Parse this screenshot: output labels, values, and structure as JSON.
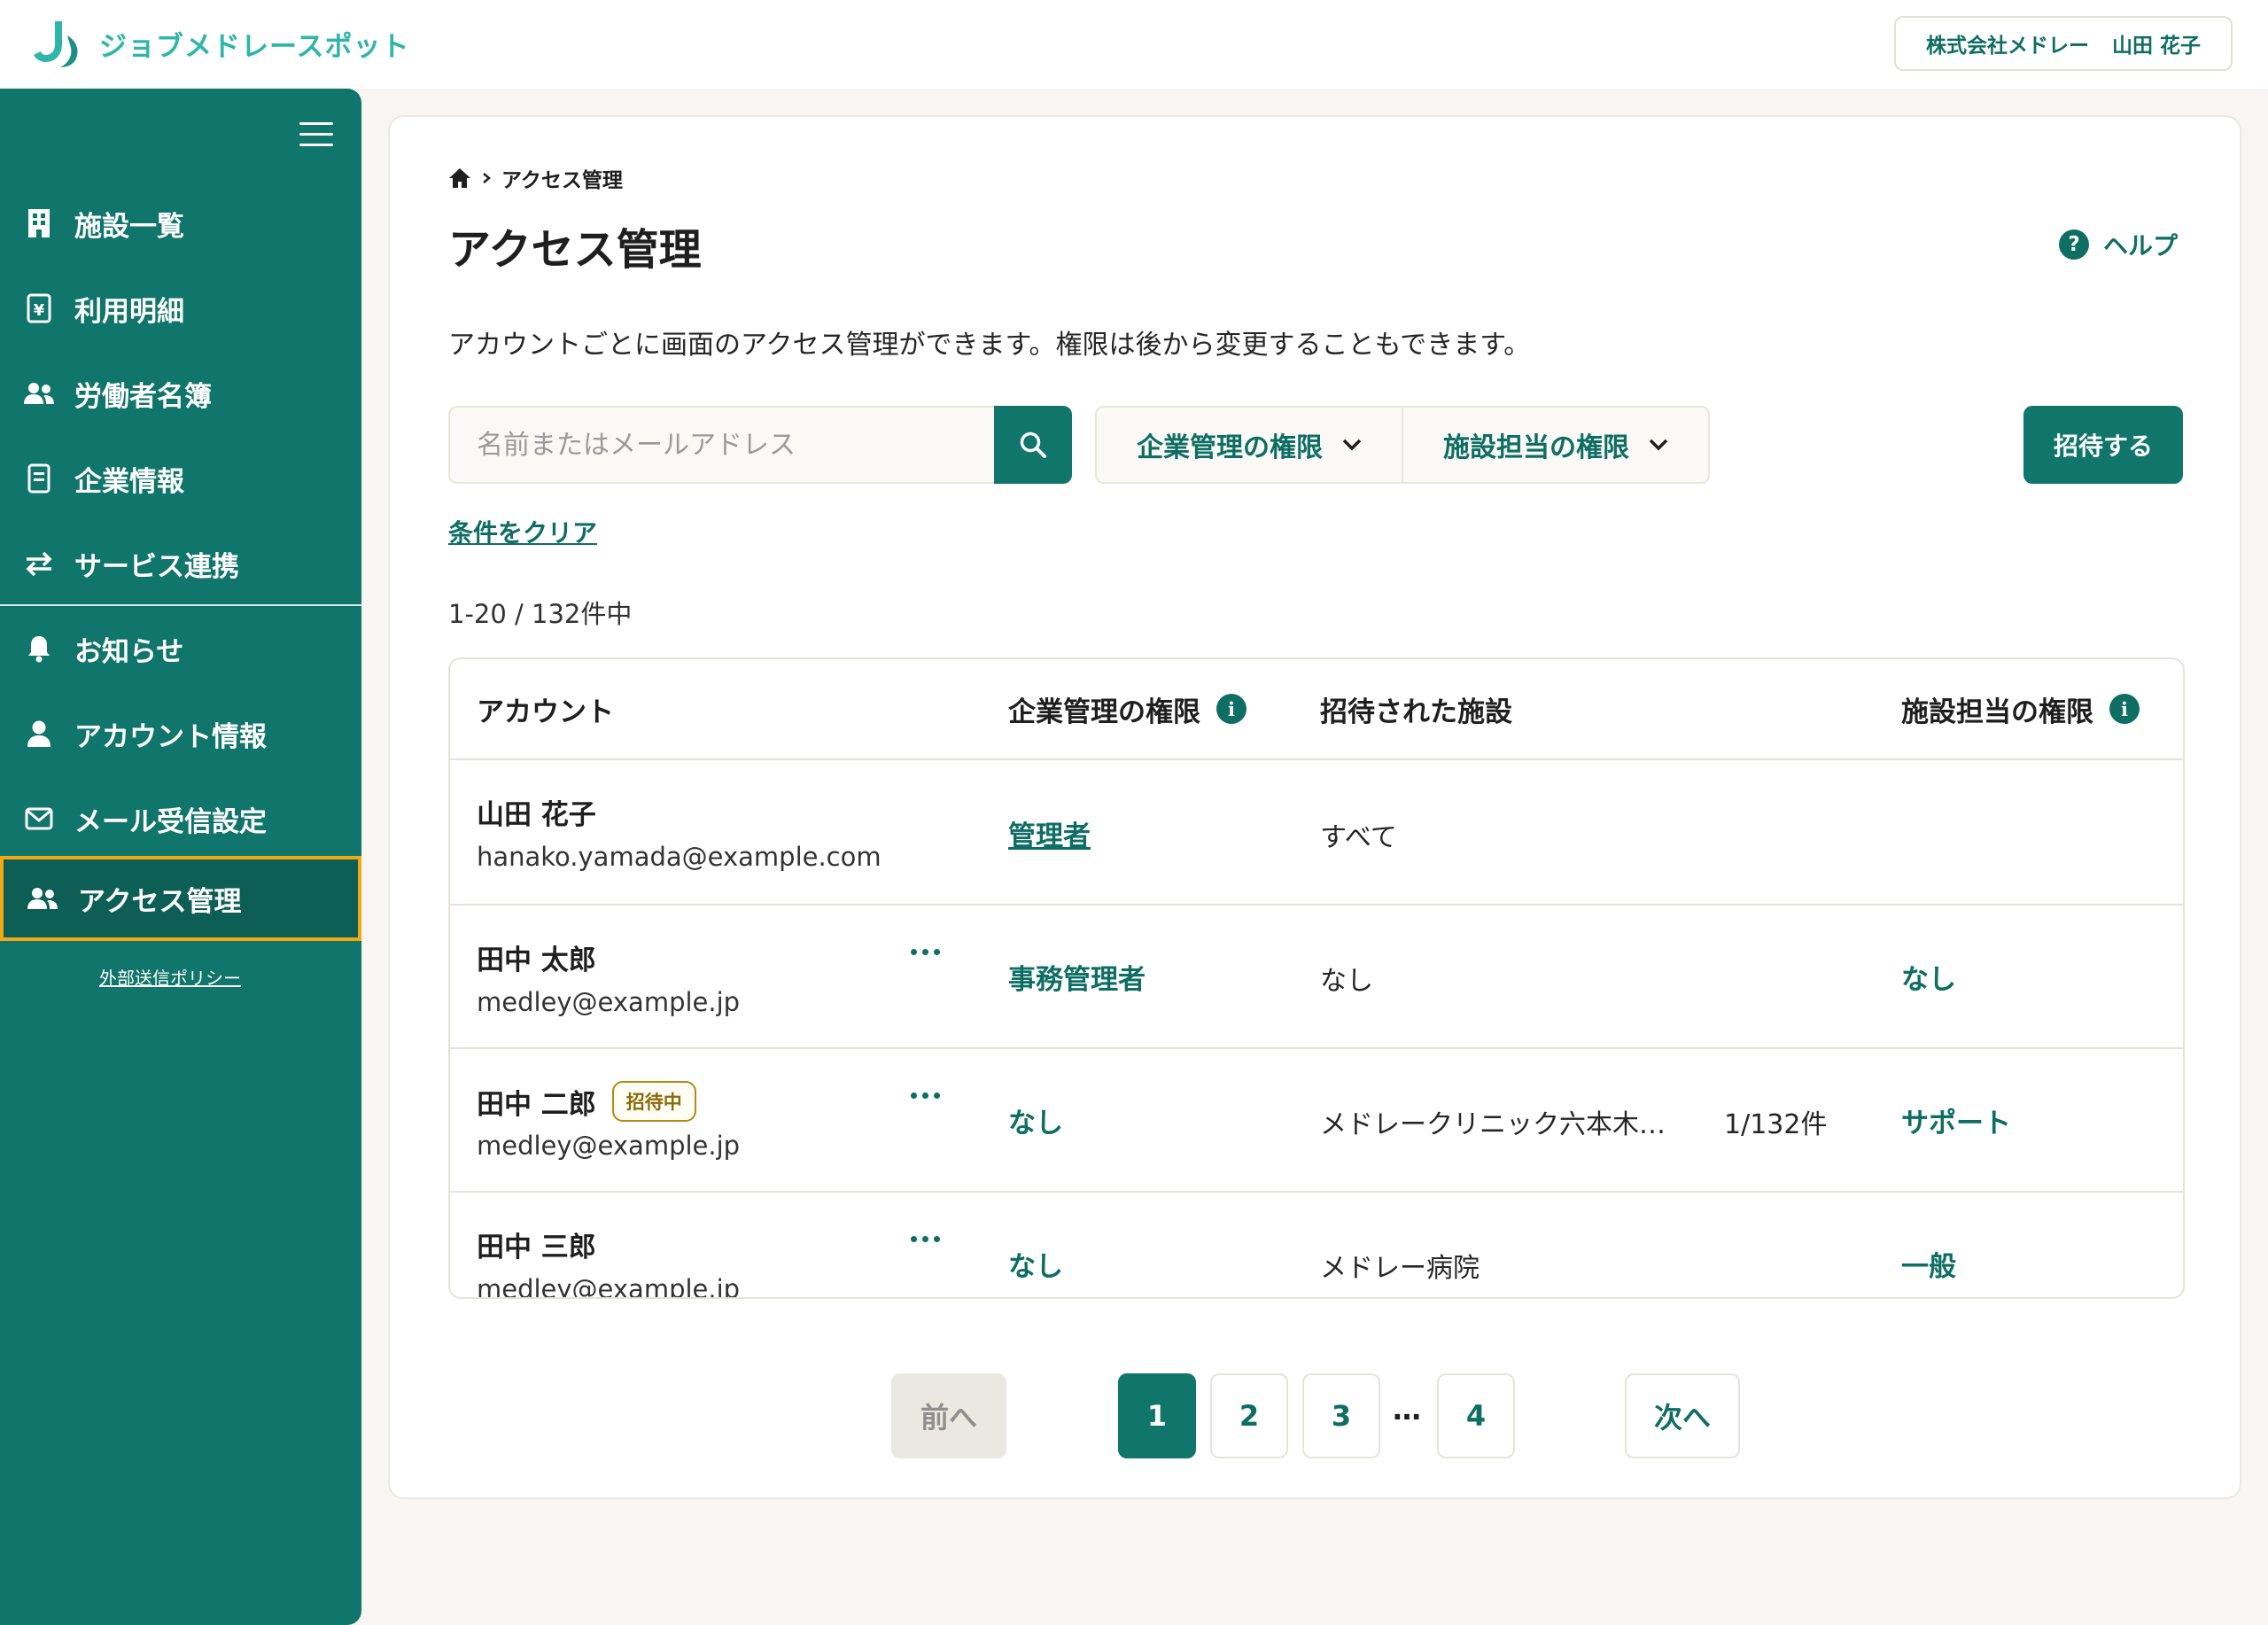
{
  "header": {
    "logo_text": "ジョブメドレースポット",
    "company": "株式会社メドレー",
    "user": "山田 花子"
  },
  "sidebar": {
    "items": [
      {
        "label": "施設一覧",
        "icon": "building-icon"
      },
      {
        "label": "利用明細",
        "icon": "receipt-icon"
      },
      {
        "label": "労働者名簿",
        "icon": "users-icon"
      },
      {
        "label": "企業情報",
        "icon": "document-icon"
      },
      {
        "label": "サービス連携",
        "icon": "sync-arrows-icon"
      },
      {
        "label": "お知らせ",
        "icon": "bell-icon"
      },
      {
        "label": "アカウント情報",
        "icon": "person-icon"
      },
      {
        "label": "メール受信設定",
        "icon": "mail-icon"
      },
      {
        "label": "アクセス管理",
        "icon": "users-icon",
        "active": true
      }
    ],
    "policy_link": "外部送信ポリシー"
  },
  "main": {
    "breadcrumb": "アクセス管理",
    "title": "アクセス管理",
    "help_label": "ヘルプ",
    "description": "アカウントごとに画面のアクセス管理ができます。権限は後から変更することもできます。",
    "search_placeholder": "名前またはメールアドレス",
    "filter_company": "企業管理の権限",
    "filter_facility": "施設担当の権限",
    "invite_label": "招待する",
    "clear_label": "条件をクリア",
    "count_text": "1-20 / 132件中"
  },
  "table": {
    "headers": {
      "account": "アカウント",
      "company_role": "企業管理の権限",
      "facilities": "招待された施設",
      "facility_role": "施設担当の権限"
    },
    "rows": [
      {
        "name": "山田 花子",
        "email": "hanako.yamada@example.com",
        "badge": "",
        "company_role": "管理者",
        "facility": "すべて",
        "facility_count": "",
        "facility_role": ""
      },
      {
        "name": "田中 太郎",
        "email": "medley@example.jp",
        "badge": "",
        "company_role": "事務管理者",
        "facility": "なし",
        "facility_count": "",
        "facility_role": "なし"
      },
      {
        "name": "田中 二郎",
        "email": "medley@example.jp",
        "badge": "招待中",
        "company_role": "なし",
        "facility": "メドレークリニック六本木…",
        "facility_count": "1/132件",
        "facility_role": "サポート"
      },
      {
        "name": "田中 三郎",
        "email": "medley@example.jp",
        "badge": "",
        "company_role": "なし",
        "facility": "メドレー病院",
        "facility_count": "",
        "facility_role": "一般"
      }
    ]
  },
  "pagination": {
    "prev": "前へ",
    "next": "次へ",
    "pages": [
      "1",
      "2",
      "3",
      "4"
    ],
    "current": "1",
    "ellipsis": "…"
  },
  "colors": {
    "primary": "#10756a",
    "primary_text": "#0e6e63",
    "logo": "#2fb6a9",
    "active_outline": "#f3a712",
    "badge": "#b58a12"
  }
}
